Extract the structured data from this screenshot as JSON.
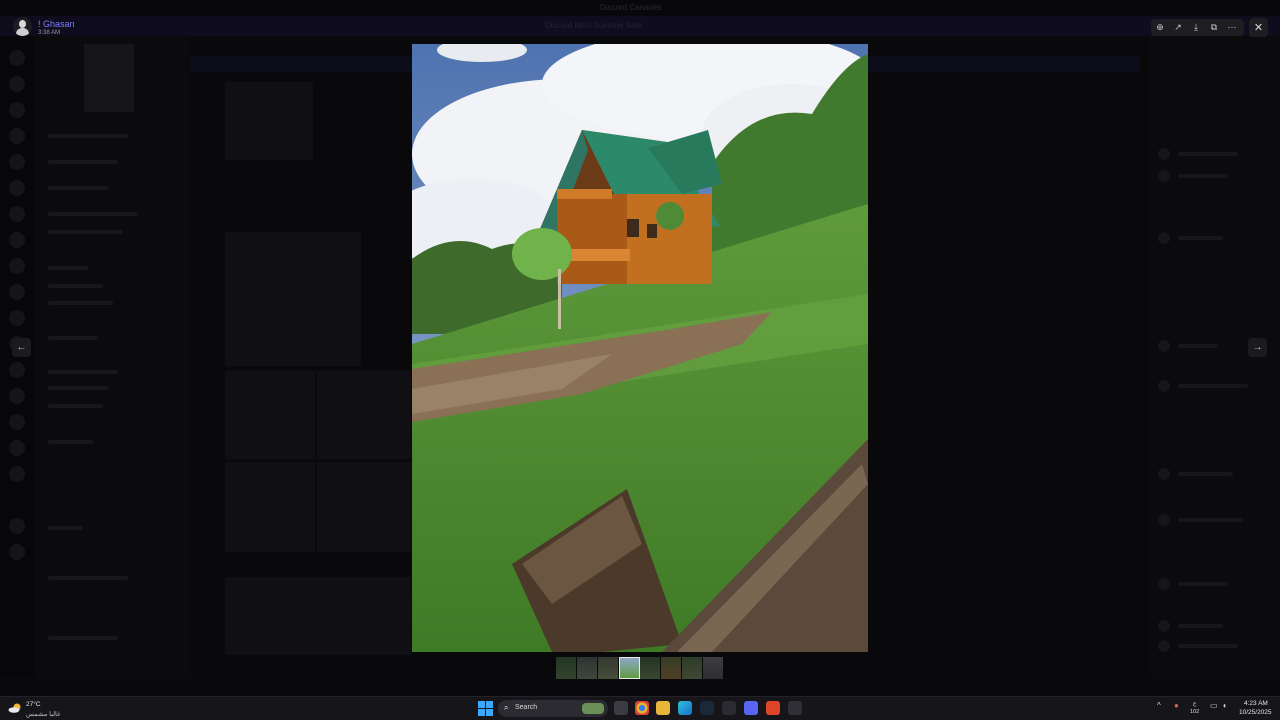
{
  "window": {
    "title": "Discord Canaries"
  },
  "notice": {
    "text": "Discord Nitro Summer Sale"
  },
  "viewer": {
    "author": "! Ghasan",
    "timestamp": "3:38 AM",
    "toolbar": [
      {
        "name": "zoom-icon",
        "glyph": "⊕"
      },
      {
        "name": "forward-icon",
        "glyph": "↗"
      },
      {
        "name": "download-icon",
        "glyph": "⤓"
      },
      {
        "name": "open-external-icon",
        "glyph": "⧉"
      },
      {
        "name": "more-icon",
        "glyph": "⋯"
      }
    ],
    "close_glyph": "✕",
    "prev_glyph": "←",
    "next_glyph": "→",
    "thumbnail_count": 8,
    "active_thumbnail": 4
  },
  "taskbar": {
    "weather_temp": "27°C",
    "weather_desc": "غالبا مشمس",
    "search_label": "Search",
    "search_glyph": "⌕",
    "tray_chevron": "^",
    "lang_line1": "ع",
    "lang_line2": "102",
    "time": "4:23 AM",
    "date": "10/25/2025"
  },
  "colors": {
    "accent": "#7c80ff",
    "overlay": "#050507",
    "start": "#3da8ff"
  }
}
